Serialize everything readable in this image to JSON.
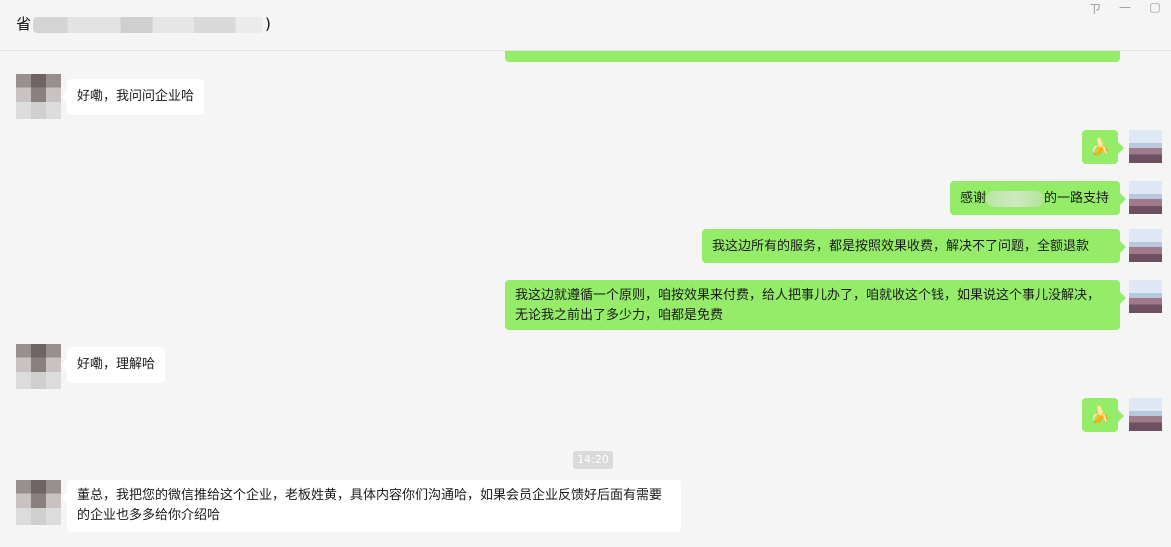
{
  "header": {
    "title_prefix": "省",
    "title_suffix": ")"
  },
  "window_controls": {
    "pin": "ㄗ",
    "minimize": "—",
    "maximize": "▢"
  },
  "messages": [
    {
      "dir": "in",
      "text": "好嘞，我问问企业哈"
    },
    {
      "dir": "out",
      "emoji": "🍌"
    },
    {
      "dir": "out",
      "text_before": "感谢",
      "text_after": "的一路支持"
    },
    {
      "dir": "out",
      "text": "我这边所有的服务，都是按照效果收费，解决不了问题，全额退款"
    },
    {
      "dir": "out",
      "text": "我这边就遵循一个原则，咱按效果来付费，给人把事儿办了，咱就收这个钱，如果说这个事儿没解决，无论我之前出了多少力，咱都是免费"
    },
    {
      "dir": "in",
      "text": "好嘞，理解哈"
    },
    {
      "dir": "out",
      "emoji": "🍌"
    },
    {
      "dir": "in",
      "text": "董总，我把您的微信推给这个企业，老板姓黄，具体内容你们沟通哈，如果会员企业反馈好后面有需要的企业也多多给你介绍哈"
    }
  ],
  "timestamp": "14:20"
}
